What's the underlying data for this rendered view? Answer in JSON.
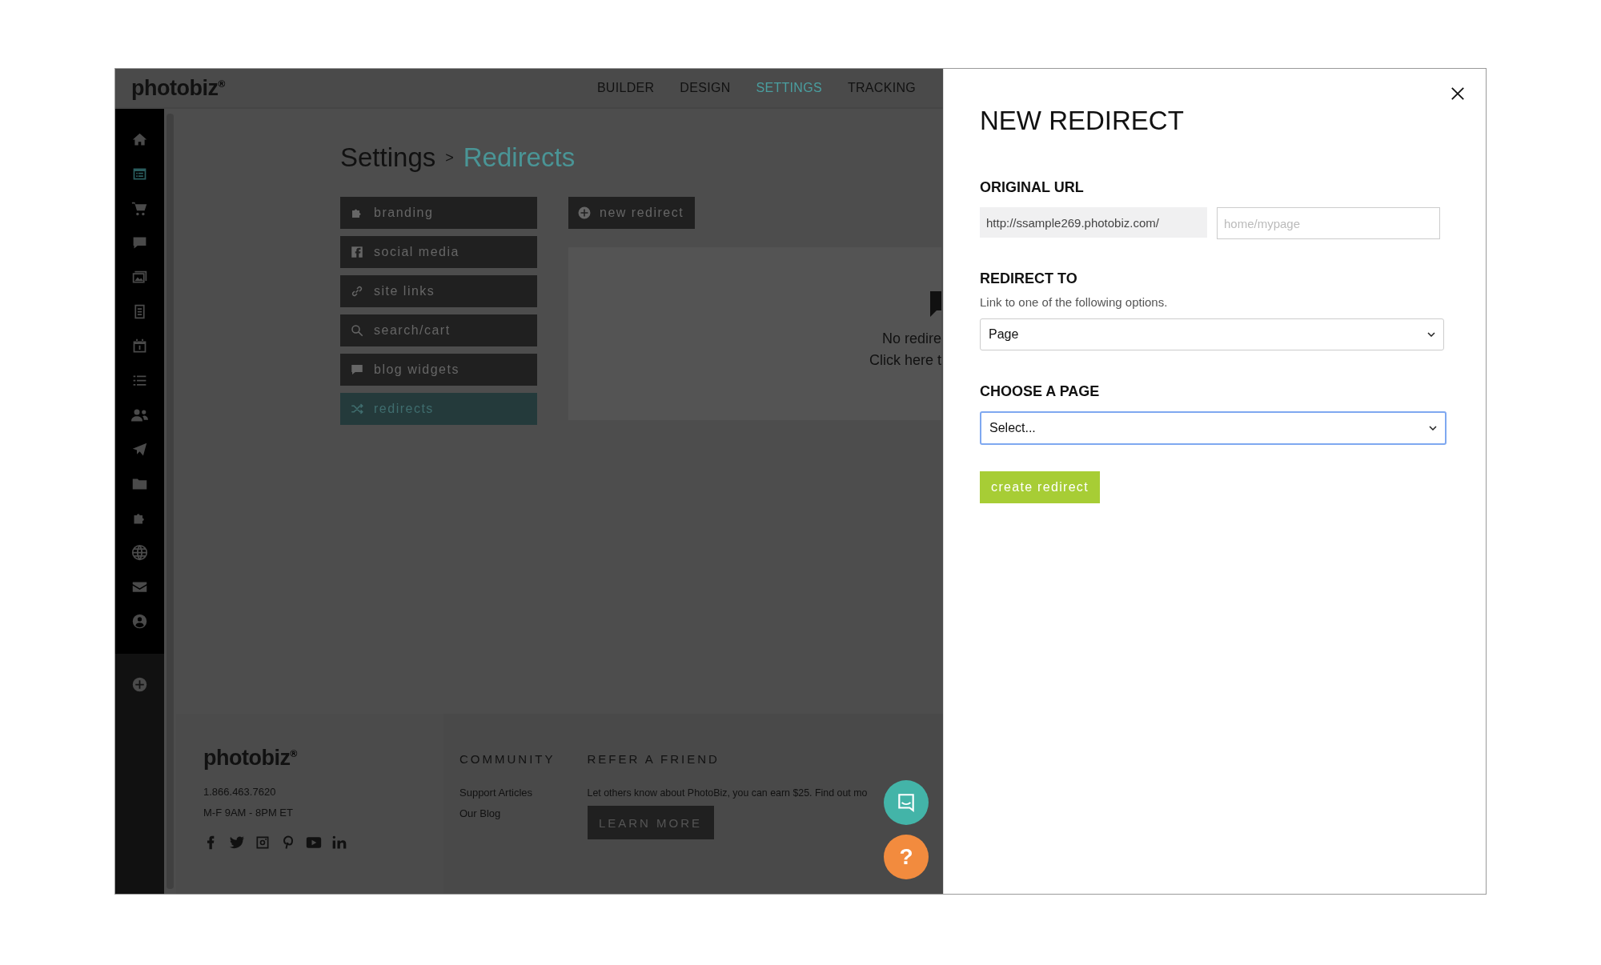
{
  "topbar": {
    "logo": "photobiz$^{®}$",
    "tabs": [
      {
        "label": "BUILDER",
        "selected": false
      },
      {
        "label": "DESIGN",
        "selected": false
      },
      {
        "label": "SETTINGS",
        "selected": true
      },
      {
        "label": "TRACKING",
        "selected": false
      }
    ]
  },
  "sidebar": {
    "items": [
      {
        "selected": false
      },
      {
        "selected": true
      },
      {
        "selected": false
      },
      {
        "selected": false
      },
      {
        "selected": false
      },
      {
        "selected": false
      },
      {
        "selected": false
      },
      {
        "selected": false
      },
      {
        "selected": false
      },
      {
        "selected": false
      },
      {
        "selected": false
      },
      {
        "selected": false
      },
      {
        "selected": false
      },
      {
        "selected": false
      },
      {
        "selected": false
      }
    ]
  },
  "breadcrumb": {
    "parent": "Settings",
    "separator": ">",
    "current": "Redirects"
  },
  "settings_menu": [
    {
      "label": "branding",
      "selected": false
    },
    {
      "label": "social media",
      "selected": false
    },
    {
      "label": "site links",
      "selected": false
    },
    {
      "label": "search/cart",
      "selected": false
    },
    {
      "label": "blog widgets",
      "selected": false
    },
    {
      "label": "redirects",
      "selected": true
    }
  ],
  "new_redirect_button": "new redirect",
  "empty_state": {
    "line_1": "No redire",
    "line_2": "Click here t"
  },
  "footer": {
    "logo": "photobiz$^{®}$",
    "phone": "1.866.463.7620",
    "hours": "M-F 9AM - 8PM ET",
    "community": {
      "heading": "COMMUNITY",
      "links": [
        "Support Articles",
        "Our Blog"
      ]
    },
    "refer": {
      "heading": "REFER A FRIEND",
      "text": "Let others know about PhotoBiz, you can earn $25. Find out mo",
      "button": "LEARN MORE"
    }
  },
  "help_button": "?",
  "modal": {
    "title": "NEW REDIRECT",
    "original_url": {
      "label": "ORIGINAL URL",
      "prefix": "http://ssample269.photobiz.com/",
      "placeholder": "home/mypage"
    },
    "redirect_to": {
      "label": "REDIRECT TO",
      "hint": "Link to one of the following options.",
      "value": "Page"
    },
    "choose_page": {
      "label": "CHOOSE A PAGE",
      "value": "Select...",
      "focused": true
    },
    "submit": "create redirect"
  }
}
